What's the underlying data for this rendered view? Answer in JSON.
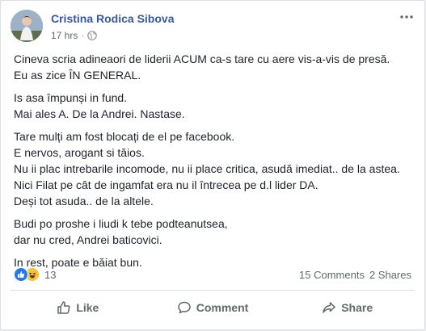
{
  "post": {
    "author": "Cristina Rodica Sibova",
    "time": "17 hrs",
    "separator": "·",
    "privacy_icon": "globe-icon",
    "more_icon": "more-options-icon",
    "paragraphs": [
      [
        "Cineva scria adineaori de liderii ACUM ca-s tare cu aere vis-a-vis de presă.",
        "Eu as zice ÎN GENERAL."
      ],
      [
        "Is asa împunși in fund.",
        "Mai ales A. De la Andrei. Nastase."
      ],
      [
        "Tare mulți am fost blocați de el pe facebook.",
        "E nervos, arogant si tăios.",
        "Nu ii plac intrebarile incomode, nu ii place critica, asudă imediat.. de la astea.",
        "Nici Filat pe cât de ingamfat era nu il întrecea pe d.l lider DA.",
        "Deși tot asuda.. de la altele."
      ],
      [
        "Budi po proshe i liudi k tebe podteanutsea,",
        "dar nu cred, Andrei baticovici."
      ],
      [
        "In rest, poate e băiat bun."
      ]
    ]
  },
  "stats": {
    "reaction_icons": [
      "like-reaction-icon",
      "haha-reaction-icon"
    ],
    "reaction_count": "13",
    "comments": "15 Comments",
    "shares": "2 Shares"
  },
  "actions": {
    "like_label": "Like",
    "comment_label": "Comment",
    "share_label": "Share"
  },
  "colors": {
    "author_link": "#385898",
    "like_blue": "#2078f4",
    "haha_yellow": "#f7c335",
    "secondary_text": "#606770"
  }
}
